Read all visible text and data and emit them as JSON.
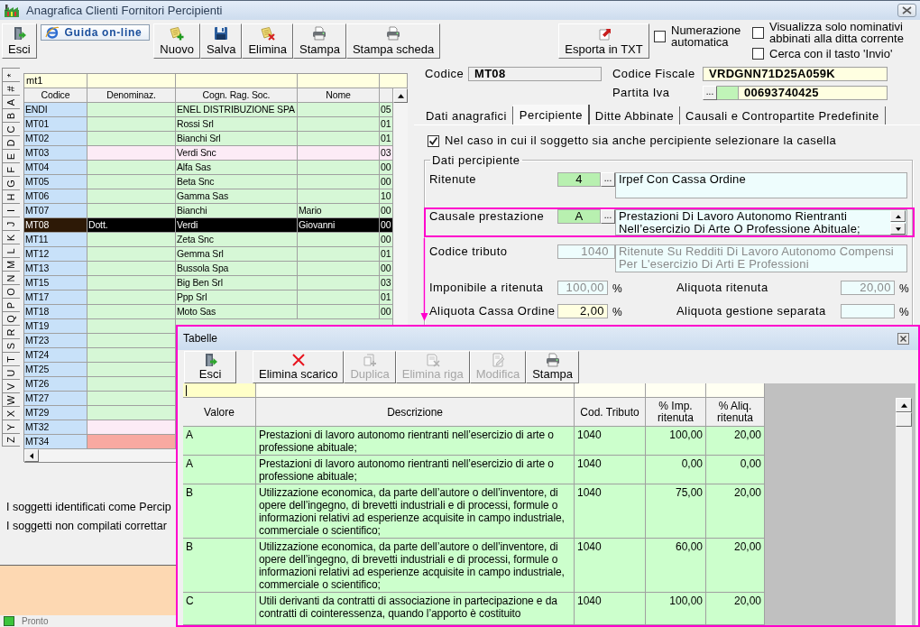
{
  "window": {
    "title": "Anagrafica Clienti Fornitori Percipienti"
  },
  "toolbar": {
    "buttons": [
      {
        "label": "Esci",
        "kind": "exit"
      },
      {
        "label": "Guida on-line",
        "kind": "help"
      },
      {
        "label": "Nuovo",
        "kind": "new"
      },
      {
        "label": "Salva",
        "kind": "save"
      },
      {
        "label": "Elimina",
        "kind": "delete"
      },
      {
        "label": "Stampa",
        "kind": "print"
      },
      {
        "label": "Stampa scheda",
        "kind": "print"
      },
      {
        "label": "Esporta in TXT",
        "kind": "export"
      }
    ],
    "options": [
      {
        "label": "Numerazione automatica",
        "checked": false
      },
      {
        "label": "Visualizza solo nominativi abbinati alla ditta corrente",
        "checked": false
      },
      {
        "label": "Cerca con il tasto 'Invio'",
        "checked": false
      }
    ]
  },
  "index_tabs": [
    {
      "label": "*",
      "selected": false
    },
    {
      "label": "#",
      "selected": false
    },
    {
      "label": "A",
      "selected": false
    },
    {
      "label": "B",
      "selected": false
    },
    {
      "label": "C",
      "selected": false
    },
    {
      "label": "D",
      "selected": false
    },
    {
      "label": "E",
      "selected": false
    },
    {
      "label": "F",
      "selected": false
    },
    {
      "label": "G",
      "selected": false
    },
    {
      "label": "H",
      "selected": false
    },
    {
      "label": "I",
      "selected": false
    },
    {
      "label": "J",
      "selected": false
    },
    {
      "label": "K",
      "selected": false
    },
    {
      "label": "L",
      "selected": false
    },
    {
      "label": "M",
      "selected": false
    },
    {
      "label": "N",
      "selected": false
    },
    {
      "label": "O",
      "selected": false
    },
    {
      "label": "P",
      "selected": false
    },
    {
      "label": "Q",
      "selected": false
    },
    {
      "label": "R",
      "selected": false
    },
    {
      "label": "S",
      "selected": false
    },
    {
      "label": "T",
      "selected": false
    },
    {
      "label": "U",
      "selected": false
    },
    {
      "label": "V",
      "selected": false
    },
    {
      "label": "W",
      "selected": false
    },
    {
      "label": "X",
      "selected": false
    },
    {
      "label": "Y",
      "selected": false
    },
    {
      "label": "Z",
      "selected": false
    }
  ],
  "client_grid": {
    "filter": "mt1",
    "columns": [
      "Codice",
      "Denominaz.",
      "Cogn. Rag. Soc.",
      "Nome"
    ],
    "rows": [
      {
        "codice": "ENDI",
        "ragione_sociale": "ENEL DISTRIBUZIONE SPA",
        "column_5": "05",
        "selected": false,
        "color": "#d6f7d6"
      },
      {
        "codice": "MT01",
        "ragione_sociale": "Rossi Srl",
        "column_5": "01",
        "selected": false,
        "color": "#d6f7d6"
      },
      {
        "codice": "MT02",
        "ragione_sociale": "Bianchi Srl",
        "column_5": "01",
        "selected": false,
        "color": "#d6f7d6"
      },
      {
        "codice": "MT03",
        "ragione_sociale": "Verdi Snc",
        "column_5": "03",
        "selected": false,
        "color": "#fcebf6"
      },
      {
        "codice": "MT04",
        "ragione_sociale": "Alfa Sas",
        "column_5": "00",
        "selected": false,
        "color": "#d6f7d6"
      },
      {
        "codice": "MT05",
        "ragione_sociale": "Beta Snc",
        "column_5": "00",
        "selected": false,
        "color": "#d6f7d6"
      },
      {
        "codice": "MT06",
        "ragione_sociale": "Gamma Sas",
        "column_5": "10",
        "selected": false,
        "color": "#d6f7d6"
      },
      {
        "codice": "MT07",
        "ragione_sociale": "Bianchi",
        "nome": "Mario",
        "column_5": "00",
        "selected": false,
        "color": "#d6f7d6"
      },
      {
        "codice": "MT08",
        "denominazione": "Dott.",
        "ragione_sociale": "Verdi",
        "nome": "Giovanni",
        "column_5": "00",
        "selected": true
      },
      {
        "codice": "MT11",
        "ragione_sociale": "Zeta Snc",
        "column_5": "00",
        "selected": false,
        "color": "#d6f7d6"
      },
      {
        "codice": "MT12",
        "ragione_sociale": "Gemma Srl",
        "column_5": "01",
        "selected": false,
        "color": "#d6f7d6"
      },
      {
        "codice": "MT13",
        "ragione_sociale": "Bussola Spa",
        "column_5": "00",
        "selected": false,
        "color": "#d6f7d6"
      },
      {
        "codice": "MT15",
        "ragione_sociale": "Big Ben Srl",
        "column_5": "03",
        "selected": false,
        "color": "#d6f7d6"
      },
      {
        "codice": "MT17",
        "ragione_sociale": "Ppp Srl",
        "column_5": "01",
        "selected": false,
        "color": "#d6f7d6"
      },
      {
        "codice": "MT18",
        "ragione_sociale": "Moto Sas",
        "column_5": "00",
        "selected": false,
        "color": "#d6f7d6"
      },
      {
        "codice": "MT19",
        "selected": false,
        "color": "#d6f7d6"
      },
      {
        "codice": "MT23",
        "selected": false,
        "color": "#d6f7d6"
      },
      {
        "codice": "MT24",
        "selected": false,
        "color": "#d6f7d6"
      },
      {
        "codice": "MT25",
        "selected": false,
        "color": "#d6f7d6"
      },
      {
        "codice": "MT26",
        "selected": false,
        "color": "#d6f7d6"
      },
      {
        "codice": "MT27",
        "selected": false,
        "color": "#d6f7d6"
      },
      {
        "codice": "MT29",
        "selected": false,
        "color": "#d6f7d6"
      },
      {
        "codice": "MT32",
        "selected": false,
        "color": "#fcebf6"
      },
      {
        "codice": "MT34",
        "selected": false,
        "color": "#f8a9a1"
      }
    ]
  },
  "notes": [
    "I soggetti identificati come Percip",
    "I soggetti non compilati correttar"
  ],
  "record": {
    "codice": {
      "label": "Codice",
      "value": "MT08"
    },
    "codice_fiscale": {
      "label": "Codice Fiscale",
      "value": "VRDGNN71D25A059K"
    },
    "partita_iva": {
      "label": "Partita Iva",
      "button": "...",
      "value": "00693740425"
    }
  },
  "tabs": [
    {
      "label": "Dati anagrafici",
      "selected": false
    },
    {
      "label": "Percipiente",
      "selected": true
    },
    {
      "label": "Ditte Abbinate",
      "selected": false
    },
    {
      "label": "Causali e Contropartite Predefinite",
      "selected": false
    }
  ],
  "percipiente": {
    "checkbox": {
      "label": "Nel caso in cui il soggetto sia anche percipiente selezionare la casella",
      "checked": true
    },
    "group_title": "Dati percipiente",
    "ritenute": {
      "label": "Ritenute",
      "code": "4",
      "button": "...",
      "description": "Irpef Con Cassa Ordine"
    },
    "causale": {
      "label": "Causale prestazione",
      "code": "A",
      "button": "...",
      "description": "Prestazioni Di Lavoro Autonomo Rientranti Nell’esercizio Di Arte O Professione Abituale;"
    },
    "codice_tributo": {
      "label": "Codice tributo",
      "code": "1040",
      "description": "Ritenute Su Redditi Di Lavoro Autonomo Compensi Per L'esercizio Di Arti E Professioni",
      "disabled": true
    },
    "amounts": [
      {
        "label": "Imponibile a ritenuta",
        "value": "100,00",
        "unit": "%",
        "disabled": true
      },
      {
        "label": "Aliquota ritenuta",
        "value": "20,00",
        "unit": "%",
        "disabled": true
      },
      {
        "label": "Aliquota Cassa Ordine",
        "value": "2,00",
        "unit": "%",
        "disabled": false
      },
      {
        "label": "Aliquota gestione separata",
        "unit": "%",
        "disabled": true
      }
    ]
  },
  "dialog": {
    "title": "Tabelle",
    "buttons": [
      {
        "label": "Esci",
        "kind": "exit",
        "disabled": false
      },
      {
        "label": "Elimina scarico",
        "kind": "remove",
        "disabled": false
      },
      {
        "label": "Duplica",
        "kind": "duplicate",
        "disabled": true
      },
      {
        "label": "Elimina riga",
        "kind": "delete_row",
        "disabled": true
      },
      {
        "label": "Modifica",
        "kind": "edit",
        "disabled": true
      },
      {
        "label": "Stampa",
        "kind": "print",
        "disabled": false
      }
    ],
    "filters": [
      {
        "focused": true
      },
      {
        "focused": false
      },
      {
        "focused": false
      },
      {
        "focused": false
      },
      {
        "focused": false
      }
    ],
    "columns": [
      "Valore",
      "Descrizione",
      "Cod. Tributo",
      "% Imp. ritenuta",
      "% Aliq. ritenuta"
    ],
    "rows": [
      {
        "valore": "A",
        "descrizione": "Prestazioni di lavoro autonomo rientranti nell’esercizio di arte o professione abituale;",
        "cod_tributo": "1040",
        "imponibile": "100,00",
        "aliquota": "20,00"
      },
      {
        "valore": "A",
        "descrizione": "Prestazioni di lavoro autonomo rientranti nell’esercizio di arte o professione abituale;",
        "cod_tributo": "1040",
        "imponibile": "0,00",
        "aliquota": "0,00"
      },
      {
        "valore": "B",
        "descrizione": "Utilizzazione economica, da parte dell’autore o dell’inventore, di opere dell’ingegno, di brevetti industriali e di processi, formule o informazioni relativi ad esperienze acquisite in campo industriale, commerciale o scientifico;",
        "cod_tributo": "1040",
        "imponibile": "75,00",
        "aliquota": "20,00"
      },
      {
        "valore": "B",
        "descrizione": "Utilizzazione economica, da parte dell’autore o dell’inventore, di opere dell’ingegno, di brevetti industriali e di processi, formule o informazioni relativi ad esperienze acquisite in campo industriale, commerciale o scientifico;",
        "cod_tributo": "1040",
        "imponibile": "60,00",
        "aliquota": "20,00"
      },
      {
        "valore": "C",
        "descrizione": "Utili derivanti da contratti di associazione in partecipazione e da contratti di cointeressenza, quando l’apporto è costituito",
        "cod_tributo": "1040",
        "imponibile": "100,00",
        "aliquota": "20,00"
      }
    ]
  },
  "status_bar": {
    "text": "Pronto"
  }
}
